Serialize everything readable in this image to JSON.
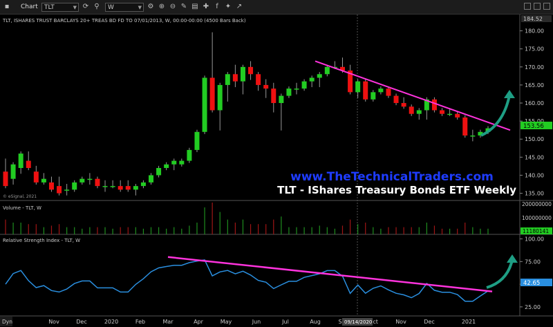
{
  "toolbar": {
    "chart_label": "Chart",
    "symbol": "TLT",
    "interval": "W"
  },
  "price_panel": {
    "header": "TLT, ISHARES TRUST BARCLAYS 20+ TREAS BD FD TO 07/01/2013, W, 00:00-00:00 (4500 Bars Back)",
    "watermark": "www.TheTechnicalTraders.com",
    "subtitle": "TLT - IShares Treasury Bonds ETF Weekly",
    "copyright": "© eSignal, 2021",
    "top_label": "184.52",
    "last_price": "153.56",
    "axis_labels": [
      "180.00",
      "175.00",
      "170.00",
      "165.00",
      "160.00",
      "155.00",
      "150.00",
      "145.00",
      "140.00",
      "135.00"
    ],
    "colors": {
      "up": "#22cc22",
      "down": "#ee1111",
      "trendline": "#ff33dd",
      "arrow": "#1e9e84"
    }
  },
  "volume_panel": {
    "header": "Volume - TLT, W",
    "last_value": "11180141",
    "axis_labels": [
      "200000000",
      "100000000"
    ]
  },
  "rsi_panel": {
    "header": "Relative Strength Index - TLT, W",
    "last_value": "42.65",
    "axis_labels": [
      "100.00",
      "75.00",
      "50.00",
      "25.00"
    ],
    "line_color": "#2a8fe0"
  },
  "x_axis": {
    "corner_label": "Dyn",
    "labels": [
      "Nov",
      "Dec",
      "2020",
      "Feb",
      "Mar",
      "Apr",
      "May",
      "Jun",
      "Jul",
      "Aug",
      "Sep",
      "Oct",
      "Nov",
      "Dec",
      "2021"
    ],
    "cursor_date": "09/14/2020"
  },
  "chart_data": {
    "type": "candlestick",
    "candles_ohlc": [
      [
        141,
        144,
        139,
        137
      ],
      [
        139,
        141,
        138,
        143
      ],
      [
        142,
        145,
        141,
        146
      ],
      [
        144,
        146,
        142,
        142
      ],
      [
        141,
        142,
        139,
        138
      ],
      [
        138,
        140,
        138,
        139
      ],
      [
        138,
        139,
        137,
        136
      ],
      [
        137,
        139,
        136,
        135
      ],
      [
        136,
        137,
        135,
        136
      ],
      [
        136,
        138,
        137,
        138
      ],
      [
        138,
        139,
        138,
        139
      ],
      [
        139,
        140,
        138,
        139
      ],
      [
        139,
        139,
        137,
        137
      ],
      [
        137,
        138,
        136,
        137
      ],
      [
        137,
        138,
        137,
        137
      ],
      [
        137,
        138,
        137,
        136
      ],
      [
        137,
        138,
        137,
        136
      ],
      [
        136,
        136,
        135,
        137
      ],
      [
        137,
        138,
        137,
        138
      ],
      [
        138,
        140,
        138,
        140
      ],
      [
        140,
        142,
        140,
        142
      ],
      [
        142,
        143,
        142,
        143
      ],
      [
        143,
        144,
        142,
        144
      ],
      [
        143,
        144,
        144,
        144
      ],
      [
        144,
        146,
        144,
        147
      ],
      [
        147,
        152,
        147,
        152
      ],
      [
        152,
        165,
        152,
        167
      ],
      [
        167,
        179,
        170,
        158
      ],
      [
        158,
        165,
        153,
        165
      ],
      [
        165,
        166,
        161,
        168
      ],
      [
        168,
        170,
        165,
        166
      ],
      [
        166,
        169,
        163,
        170
      ],
      [
        170,
        171,
        167,
        168
      ],
      [
        168,
        168,
        164,
        165
      ],
      [
        165,
        166,
        162,
        164
      ],
      [
        164,
        165,
        158,
        160
      ],
      [
        160,
        161,
        153,
        162
      ],
      [
        162,
        164,
        162,
        164
      ],
      [
        164,
        165,
        163,
        164
      ],
      [
        164,
        166,
        164,
        166
      ],
      [
        166,
        167,
        165,
        167
      ],
      [
        167,
        168,
        165,
        168
      ],
      [
        168,
        170,
        168,
        170
      ],
      [
        170,
        171,
        170,
        170
      ],
      [
        170,
        172,
        169,
        169
      ],
      [
        169,
        170,
        163,
        163
      ],
      [
        163,
        165,
        162,
        166
      ],
      [
        166,
        166,
        161,
        161
      ],
      [
        161,
        163,
        162,
        163
      ],
      [
        163,
        164,
        164,
        164
      ],
      [
        164,
        164,
        162,
        162
      ],
      [
        162,
        161,
        160,
        160
      ],
      [
        160,
        161,
        159,
        159
      ],
      [
        159,
        159,
        157,
        157
      ],
      [
        157,
        158,
        156,
        158
      ],
      [
        158,
        160,
        156,
        161
      ],
      [
        161,
        161,
        158,
        158
      ],
      [
        158,
        158,
        157,
        157
      ],
      [
        157,
        158,
        157,
        157
      ],
      [
        157,
        157,
        156,
        156
      ],
      [
        156,
        154,
        151,
        151
      ],
      [
        151,
        152,
        150,
        151
      ],
      [
        151,
        152,
        151,
        152
      ],
      [
        152,
        153,
        152,
        153
      ]
    ],
    "trendline_price": {
      "from": [
        171.6,
        "Aug"
      ],
      "to": [
        152.5,
        "2021"
      ]
    },
    "trendline_rsi": {
      "from": [
        80,
        "Mar"
      ],
      "to": [
        42,
        "2021"
      ]
    },
    "price_range": [
      133,
      184.52
    ],
    "rsi_range": [
      15,
      105
    ]
  }
}
